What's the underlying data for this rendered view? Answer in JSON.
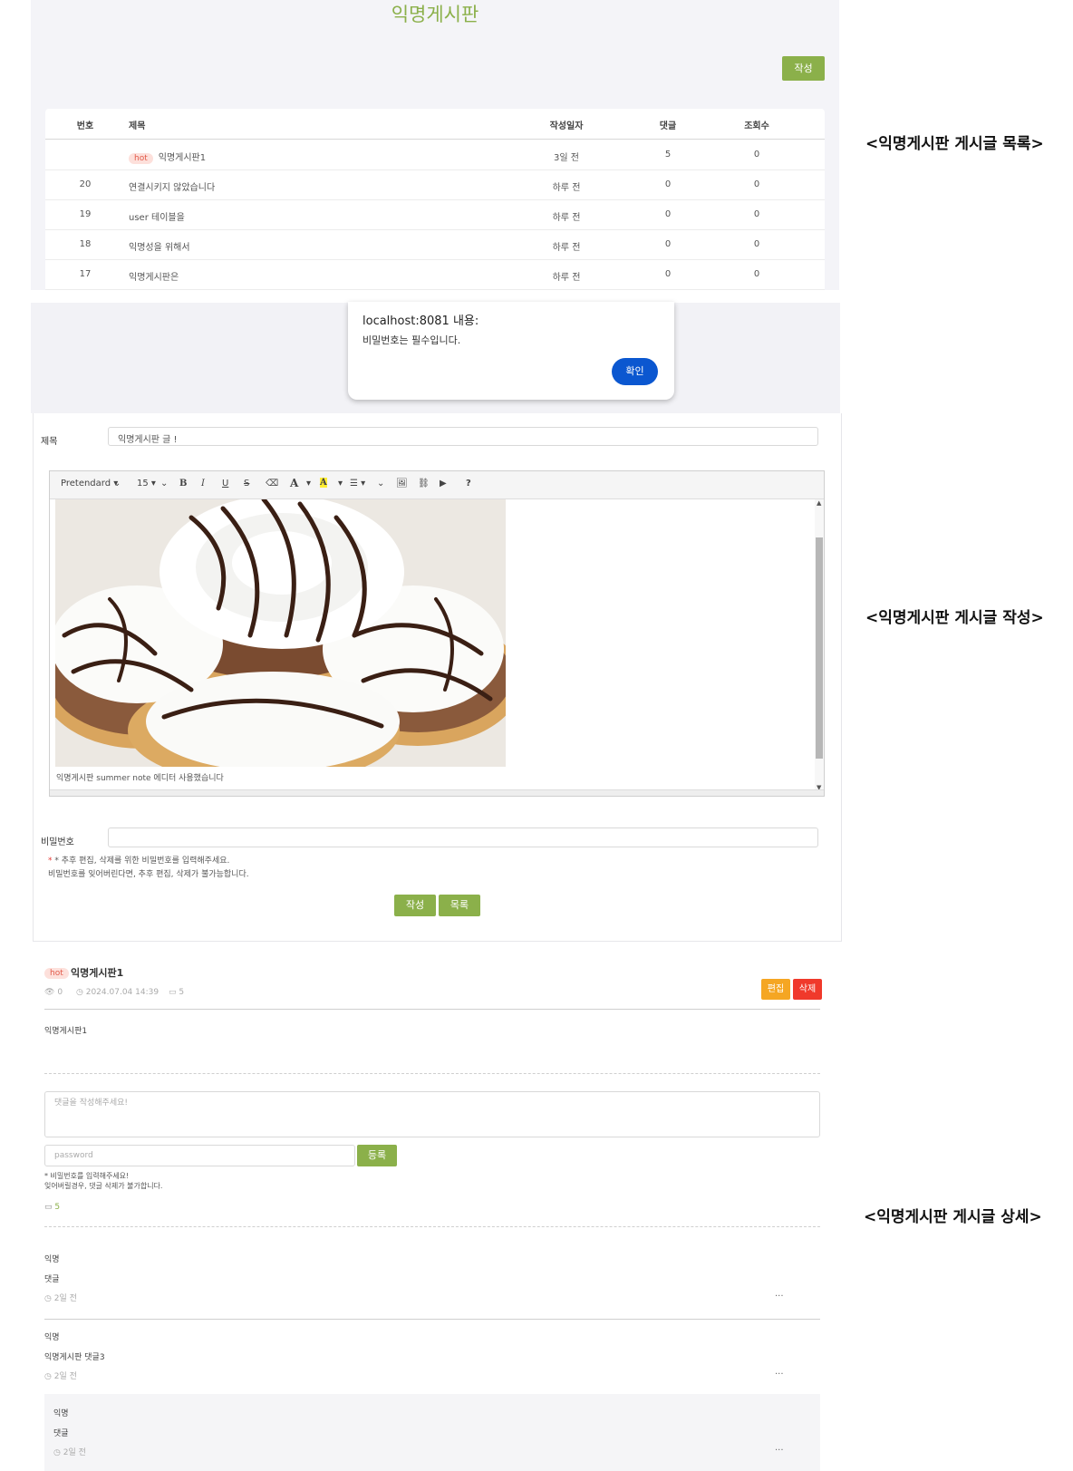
{
  "list": {
    "title": "익명게시판",
    "write_button": "작성",
    "columns": [
      "번호",
      "제목",
      "작성일자",
      "댓글",
      "조회수"
    ],
    "rows": [
      {
        "num": "",
        "badge": "hot",
        "title": "익명게시판1",
        "date": "3일 전",
        "comments": "5",
        "views": "0"
      },
      {
        "num": "20",
        "badge": "",
        "title": "연결시키지 않았습니다",
        "date": "하루 전",
        "comments": "0",
        "views": "0"
      },
      {
        "num": "19",
        "badge": "",
        "title": "user 테이블을",
        "date": "하루 전",
        "comments": "0",
        "views": "0"
      },
      {
        "num": "18",
        "badge": "",
        "title": "익명성을 위해서",
        "date": "하루 전",
        "comments": "0",
        "views": "0"
      },
      {
        "num": "17",
        "badge": "",
        "title": "익명게시판은",
        "date": "하루 전",
        "comments": "0",
        "views": "0"
      }
    ]
  },
  "labels": {
    "list": "<익명게시판 게시글 목록>",
    "write": "<익명게시판 게시글 작성>",
    "detail": "<익명게시판 게시글 상세>"
  },
  "alert": {
    "title": "localhost:8081 내용:",
    "message": "비밀번호는 필수입니다.",
    "ok": "확인"
  },
  "write": {
    "title_label": "제목",
    "title_value": "익명게시판 글 !",
    "toolbar": {
      "font": "Pretendard ▾",
      "size": "15 ▾",
      "bold": "B",
      "italic": "I",
      "underline": "U",
      "strike": "S",
      "eraser": "⌫",
      "font_color": "A",
      "highlight": "A",
      "list": "☰ ▾",
      "image": "🖼",
      "link": "⛓",
      "video": "▶",
      "help": "?"
    },
    "editor_text": "익명게시판 summer note 에디터 사용했습니다",
    "password_label": "비밀번호",
    "note1": "* 추후 편집, 삭제를 위한 비밀번호를 입력해주세요.",
    "note2": "비밀번호를 잊어버린다면, 추후 편집, 삭제가 불가능합니다.",
    "submit": "작성",
    "list_button": "목록"
  },
  "detail": {
    "badge": "hot",
    "title": "익명게시판1",
    "views": "0",
    "datetime": "2024.07.04 14:39",
    "comment_count": "5",
    "edit": "편집",
    "delete": "삭제",
    "body": "익명게시판1",
    "comment_placeholder": "댓글을 작성해주세요!",
    "password_placeholder": "password",
    "register": "등록",
    "note1": "* 비밀번호를 입력해주세요!",
    "note2": "잊어버릴경우, 댓글 삭제가 불가합니다.",
    "comments_total": "5",
    "comments": [
      {
        "author": "익명",
        "text": "댓글",
        "time": "2일 전",
        "more": "..."
      },
      {
        "author": "익명",
        "text": "익명게시판 댓글3",
        "time": "2일 전",
        "more": "..."
      },
      {
        "author": "익명",
        "text": "댓글",
        "time": "2일 전",
        "more": "..."
      }
    ]
  },
  "colors": {
    "accent": "#8bb04a",
    "hot_bg": "#fde0db",
    "edit": "#f5a623",
    "delete": "#f0392b",
    "confirm": "#0b57d0"
  }
}
